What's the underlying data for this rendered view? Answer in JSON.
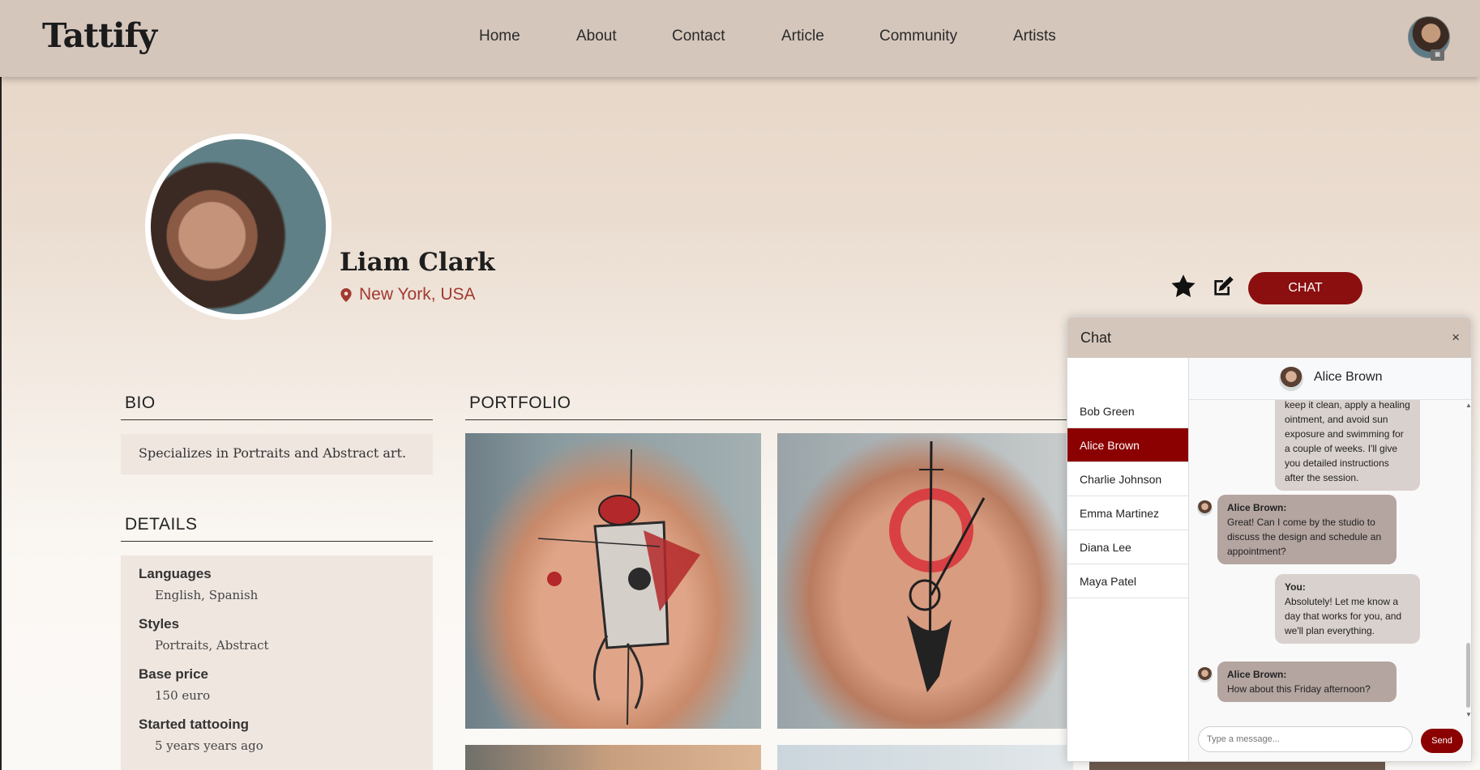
{
  "brand": {
    "logo": "Tattify"
  },
  "nav": {
    "items": [
      {
        "label": "Home"
      },
      {
        "label": "About"
      },
      {
        "label": "Contact"
      },
      {
        "label": "Article"
      },
      {
        "label": "Community"
      },
      {
        "label": "Artists"
      }
    ]
  },
  "profile": {
    "name": "Liam Clark",
    "location": "New York, USA",
    "chat_button": "CHAT"
  },
  "bio": {
    "title": "BIO",
    "text": "Specializes in Portraits and Abstract art."
  },
  "details": {
    "title": "DETAILS",
    "items": [
      {
        "label": "Languages",
        "value": "English, Spanish"
      },
      {
        "label": "Styles",
        "value": "Portraits, Abstract"
      },
      {
        "label": "Base price",
        "value": "150 euro"
      },
      {
        "label": "Started tattooing",
        "value": "5 years years ago"
      }
    ]
  },
  "portfolio": {
    "title": "PORTFOLIO"
  },
  "chat": {
    "title": "Chat",
    "close": "×",
    "contacts": [
      {
        "name": "Bob Green",
        "active": false
      },
      {
        "name": "Alice Brown",
        "active": true
      },
      {
        "name": "Charlie Johnson",
        "active": false
      },
      {
        "name": "Emma Martinez",
        "active": false
      },
      {
        "name": "Diana Lee",
        "active": false
      },
      {
        "name": "Maya Patel",
        "active": false
      }
    ],
    "active_contact": "Alice Brown",
    "messages": [
      {
        "sender": "",
        "text": "keep it clean, apply a healing ointment, and avoid sun exposure and swimming for a couple of weeks. I'll give you detailed instructions after the session."
      },
      {
        "sender": "Alice Brown:",
        "text": "Great! Can I come by the studio to discuss the design and schedule an appointment?"
      },
      {
        "sender": "You:",
        "text": "Absolutely! Let me know a day that works for you, and we'll plan everything."
      },
      {
        "sender": "Alice Brown:",
        "text": "How about this Friday afternoon?"
      }
    ],
    "input_placeholder": "Type a message...",
    "send_label": "Send"
  },
  "colors": {
    "accent": "#8b0000",
    "header_bg": "#d5c6bc",
    "location_text": "#a23a30"
  }
}
